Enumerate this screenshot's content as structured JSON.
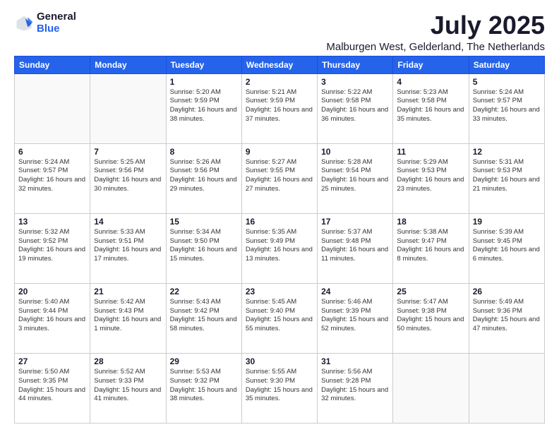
{
  "logo": {
    "general": "General",
    "blue": "Blue"
  },
  "header": {
    "month": "July 2025",
    "location": "Malburgen West, Gelderland, The Netherlands"
  },
  "weekdays": [
    "Sunday",
    "Monday",
    "Tuesday",
    "Wednesday",
    "Thursday",
    "Friday",
    "Saturday"
  ],
  "weeks": [
    [
      {
        "day": "",
        "info": ""
      },
      {
        "day": "",
        "info": ""
      },
      {
        "day": "1",
        "info": "Sunrise: 5:20 AM\nSunset: 9:59 PM\nDaylight: 16 hours and 38 minutes."
      },
      {
        "day": "2",
        "info": "Sunrise: 5:21 AM\nSunset: 9:59 PM\nDaylight: 16 hours and 37 minutes."
      },
      {
        "day": "3",
        "info": "Sunrise: 5:22 AM\nSunset: 9:58 PM\nDaylight: 16 hours and 36 minutes."
      },
      {
        "day": "4",
        "info": "Sunrise: 5:23 AM\nSunset: 9:58 PM\nDaylight: 16 hours and 35 minutes."
      },
      {
        "day": "5",
        "info": "Sunrise: 5:24 AM\nSunset: 9:57 PM\nDaylight: 16 hours and 33 minutes."
      }
    ],
    [
      {
        "day": "6",
        "info": "Sunrise: 5:24 AM\nSunset: 9:57 PM\nDaylight: 16 hours and 32 minutes."
      },
      {
        "day": "7",
        "info": "Sunrise: 5:25 AM\nSunset: 9:56 PM\nDaylight: 16 hours and 30 minutes."
      },
      {
        "day": "8",
        "info": "Sunrise: 5:26 AM\nSunset: 9:56 PM\nDaylight: 16 hours and 29 minutes."
      },
      {
        "day": "9",
        "info": "Sunrise: 5:27 AM\nSunset: 9:55 PM\nDaylight: 16 hours and 27 minutes."
      },
      {
        "day": "10",
        "info": "Sunrise: 5:28 AM\nSunset: 9:54 PM\nDaylight: 16 hours and 25 minutes."
      },
      {
        "day": "11",
        "info": "Sunrise: 5:29 AM\nSunset: 9:53 PM\nDaylight: 16 hours and 23 minutes."
      },
      {
        "day": "12",
        "info": "Sunrise: 5:31 AM\nSunset: 9:53 PM\nDaylight: 16 hours and 21 minutes."
      }
    ],
    [
      {
        "day": "13",
        "info": "Sunrise: 5:32 AM\nSunset: 9:52 PM\nDaylight: 16 hours and 19 minutes."
      },
      {
        "day": "14",
        "info": "Sunrise: 5:33 AM\nSunset: 9:51 PM\nDaylight: 16 hours and 17 minutes."
      },
      {
        "day": "15",
        "info": "Sunrise: 5:34 AM\nSunset: 9:50 PM\nDaylight: 16 hours and 15 minutes."
      },
      {
        "day": "16",
        "info": "Sunrise: 5:35 AM\nSunset: 9:49 PM\nDaylight: 16 hours and 13 minutes."
      },
      {
        "day": "17",
        "info": "Sunrise: 5:37 AM\nSunset: 9:48 PM\nDaylight: 16 hours and 11 minutes."
      },
      {
        "day": "18",
        "info": "Sunrise: 5:38 AM\nSunset: 9:47 PM\nDaylight: 16 hours and 8 minutes."
      },
      {
        "day": "19",
        "info": "Sunrise: 5:39 AM\nSunset: 9:45 PM\nDaylight: 16 hours and 6 minutes."
      }
    ],
    [
      {
        "day": "20",
        "info": "Sunrise: 5:40 AM\nSunset: 9:44 PM\nDaylight: 16 hours and 3 minutes."
      },
      {
        "day": "21",
        "info": "Sunrise: 5:42 AM\nSunset: 9:43 PM\nDaylight: 16 hours and 1 minute."
      },
      {
        "day": "22",
        "info": "Sunrise: 5:43 AM\nSunset: 9:42 PM\nDaylight: 15 hours and 58 minutes."
      },
      {
        "day": "23",
        "info": "Sunrise: 5:45 AM\nSunset: 9:40 PM\nDaylight: 15 hours and 55 minutes."
      },
      {
        "day": "24",
        "info": "Sunrise: 5:46 AM\nSunset: 9:39 PM\nDaylight: 15 hours and 52 minutes."
      },
      {
        "day": "25",
        "info": "Sunrise: 5:47 AM\nSunset: 9:38 PM\nDaylight: 15 hours and 50 minutes."
      },
      {
        "day": "26",
        "info": "Sunrise: 5:49 AM\nSunset: 9:36 PM\nDaylight: 15 hours and 47 minutes."
      }
    ],
    [
      {
        "day": "27",
        "info": "Sunrise: 5:50 AM\nSunset: 9:35 PM\nDaylight: 15 hours and 44 minutes."
      },
      {
        "day": "28",
        "info": "Sunrise: 5:52 AM\nSunset: 9:33 PM\nDaylight: 15 hours and 41 minutes."
      },
      {
        "day": "29",
        "info": "Sunrise: 5:53 AM\nSunset: 9:32 PM\nDaylight: 15 hours and 38 minutes."
      },
      {
        "day": "30",
        "info": "Sunrise: 5:55 AM\nSunset: 9:30 PM\nDaylight: 15 hours and 35 minutes."
      },
      {
        "day": "31",
        "info": "Sunrise: 5:56 AM\nSunset: 9:28 PM\nDaylight: 15 hours and 32 minutes."
      },
      {
        "day": "",
        "info": ""
      },
      {
        "day": "",
        "info": ""
      }
    ]
  ]
}
